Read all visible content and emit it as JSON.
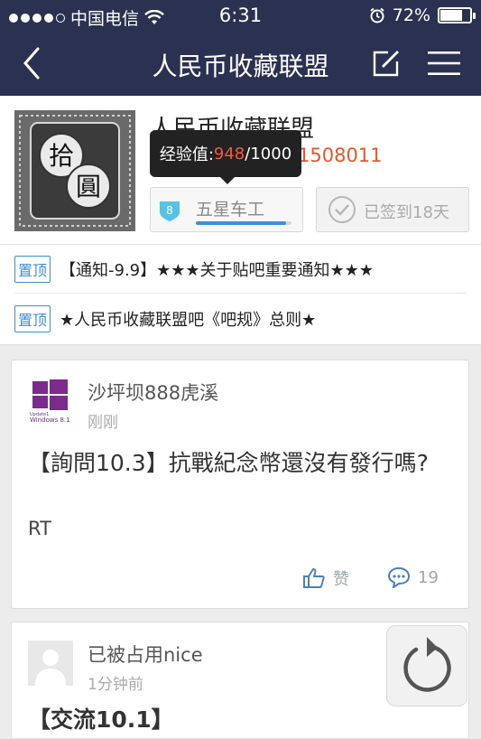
{
  "status_bar": {
    "carrier": "中国电信",
    "time": "6:31",
    "battery_percent": "72%",
    "battery_level": 0.72,
    "signal_bars": 4,
    "signal_max": 5
  },
  "nav": {
    "title": "人民币收藏联盟"
  },
  "forum": {
    "name": "人民币收藏联盟",
    "subtitle_visible": "1508011",
    "tooltip": {
      "label": "经验值:",
      "current": "948",
      "sep": "/",
      "max": "1000"
    },
    "level": {
      "badge": "8",
      "name": "五星车工",
      "progress": 0.948
    },
    "signin": {
      "label": "已签到18天"
    }
  },
  "pinned": [
    {
      "tag": "置顶",
      "text": "【通知-9.9】★★★关于贴吧重要通知★★★"
    },
    {
      "tag": "置顶",
      "text": "★人民币收藏联盟吧《吧规》总则★"
    }
  ],
  "posts": [
    {
      "author": "沙坪坝888虎溪",
      "time": "刚刚",
      "title": "【詢問10.3】抗戰紀念幣還沒有發行嗎?",
      "body": "RT",
      "like_label": "赞",
      "comment_count": "19",
      "avatar_lines": [
        "Update1",
        "Windows 8.1"
      ]
    },
    {
      "author": "已被占用nice",
      "time": "1分钟前",
      "title": "【交流10.1】"
    }
  ],
  "avatar_text": {
    "top": "拾",
    "bottom": "圓"
  },
  "colors": {
    "nav_bg": "#2b3150",
    "accent": "#3d8fe0",
    "highlight": "#f15b3e"
  }
}
